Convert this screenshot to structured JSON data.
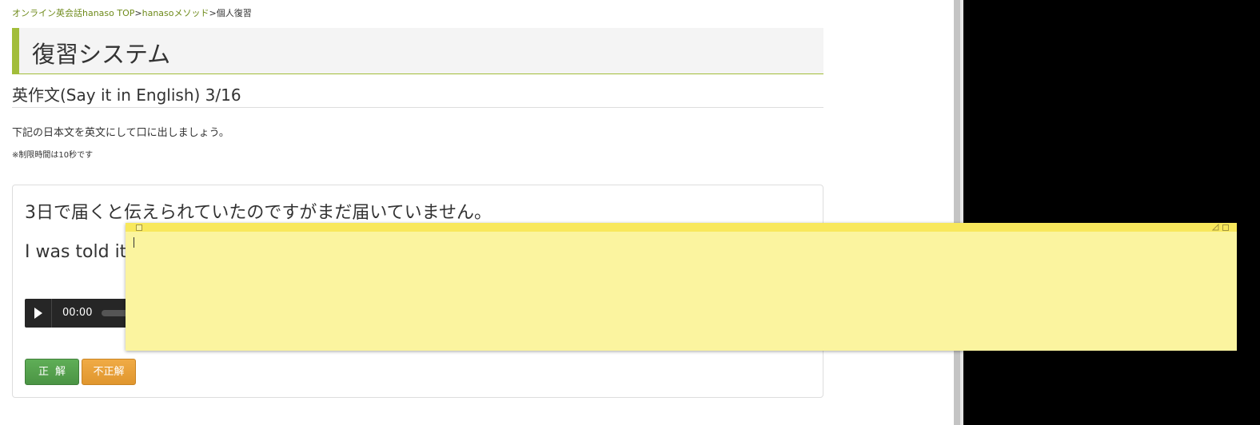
{
  "breadcrumb": {
    "link1": "オンライン英会話hanaso TOP",
    "sep1": ">",
    "link2": "hanasoメソッド",
    "sep2": ">",
    "current": "個人復習"
  },
  "page_title": "復習システム",
  "section_title": "英作文(Say it in English) 3/16",
  "instruction": "下記の日本文を英文にして口に出しましょう。",
  "note": "※制限時間は10秒です",
  "card": {
    "japanese_sentence": "3日で届くと伝えられていたのですがまだ届いていません。",
    "english_sentence": "I was told it",
    "audio": {
      "time": "00:00",
      "progress": 0
    },
    "correct_button": "正解",
    "incorrect_button": "不正解"
  },
  "sticky_note": {
    "text": ""
  },
  "colors": {
    "accent": "#a2bd3a",
    "link": "#6e8a1a",
    "correct": "#4b9444",
    "incorrect": "#e0962e",
    "sticky": "#fbf49f",
    "sticky_header": "#f8e85c"
  }
}
